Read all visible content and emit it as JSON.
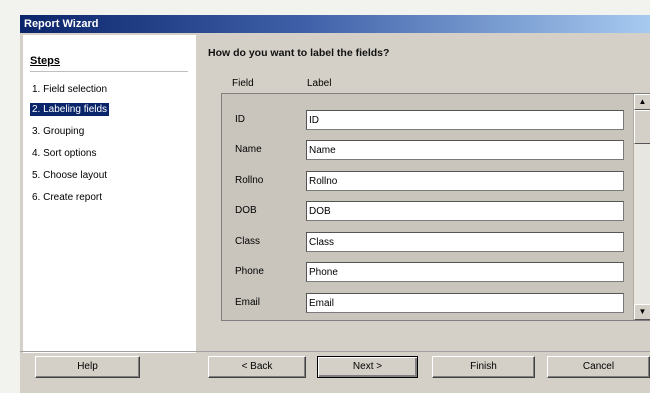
{
  "window": {
    "title": "Report Wizard"
  },
  "steps": {
    "heading": "Steps",
    "items": [
      {
        "label": "1. Field selection",
        "active": false
      },
      {
        "label": "2. Labeling fields",
        "active": true
      },
      {
        "label": "3. Grouping",
        "active": false
      },
      {
        "label": "4. Sort options",
        "active": false
      },
      {
        "label": "5. Choose layout",
        "active": false
      },
      {
        "label": "6. Create report",
        "active": false
      }
    ]
  },
  "main": {
    "question": "How do you want to label the fields?",
    "column_field": "Field",
    "column_label": "Label",
    "rows": [
      {
        "field": "ID",
        "label": "ID"
      },
      {
        "field": "Name",
        "label": "Name"
      },
      {
        "field": "Rollno",
        "label": "Rollno"
      },
      {
        "field": "DOB",
        "label": "DOB"
      },
      {
        "field": "Class",
        "label": "Class"
      },
      {
        "field": "Phone",
        "label": "Phone"
      },
      {
        "field": "Email",
        "label": "Email"
      }
    ]
  },
  "buttons": {
    "help": "Help",
    "back": "< Back",
    "next": "Next >",
    "finish": "Finish",
    "cancel": "Cancel"
  },
  "icons": {
    "scroll_up": "arrow-up-icon",
    "scroll_down": "arrow-down-icon"
  }
}
